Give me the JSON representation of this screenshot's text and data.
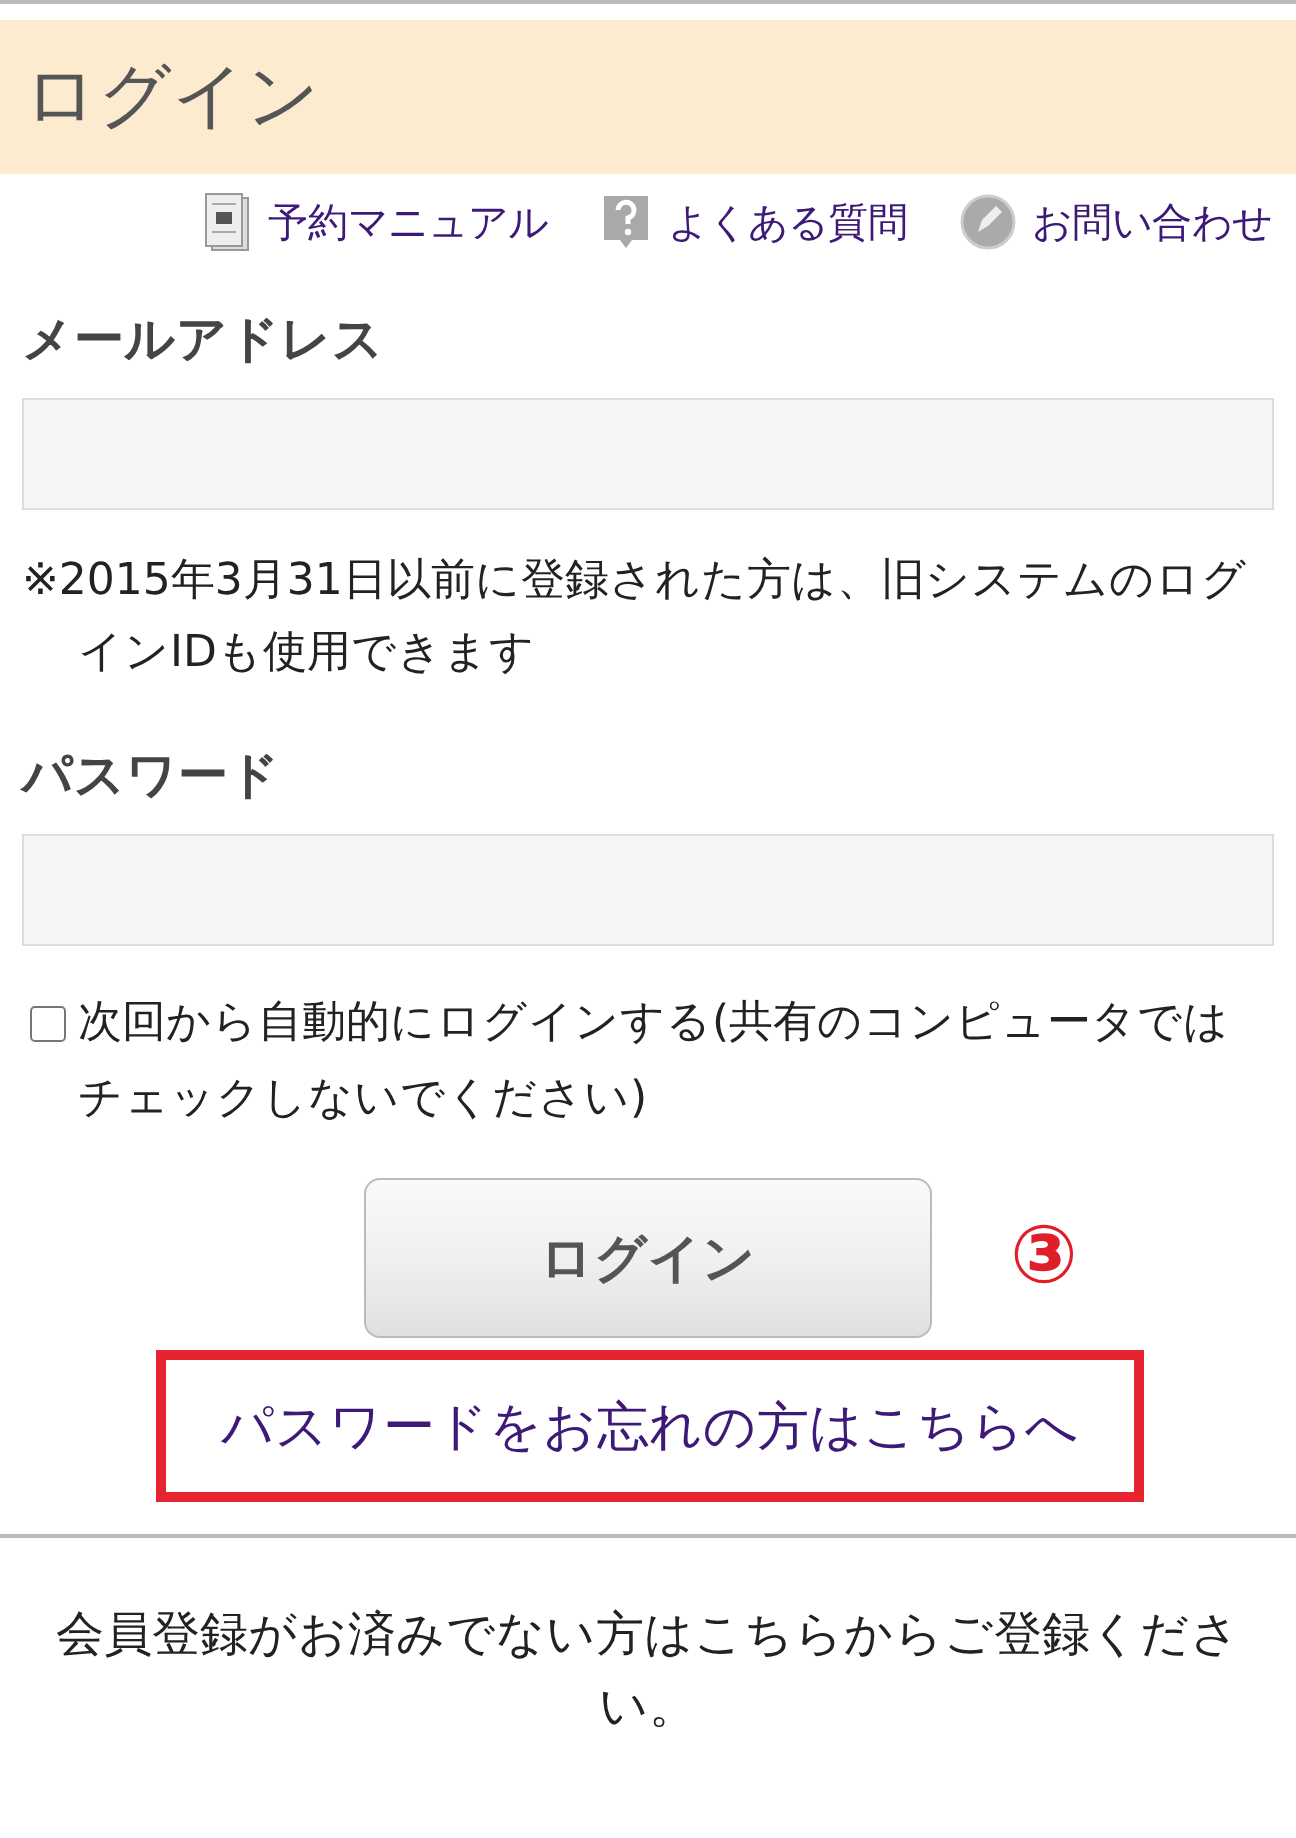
{
  "header": {
    "title": "ログイン"
  },
  "help_links": [
    {
      "kind": "manual",
      "label": "予約マニュアル"
    },
    {
      "kind": "faq",
      "label": "よくある質問"
    },
    {
      "kind": "contact",
      "label": "お問い合わせ"
    }
  ],
  "fields": [
    {
      "label": "メールアドレス",
      "note": "※2015年3月31日以前に登録された方は、旧システムのログインIDも使用できます"
    },
    {
      "label": "パスワード"
    }
  ],
  "remember": {
    "label": "次回から自動的にログインする(共有のコンピュータではチェックしないでください)",
    "checked": false
  },
  "login_button": "ログイン",
  "annotation": "③",
  "forgot_link": {
    "label": "パスワードをお忘れの方はこちらへ",
    "highlighted": true
  },
  "register_text": "会員登録がお済みでない方はこちらからご登録ください。"
}
